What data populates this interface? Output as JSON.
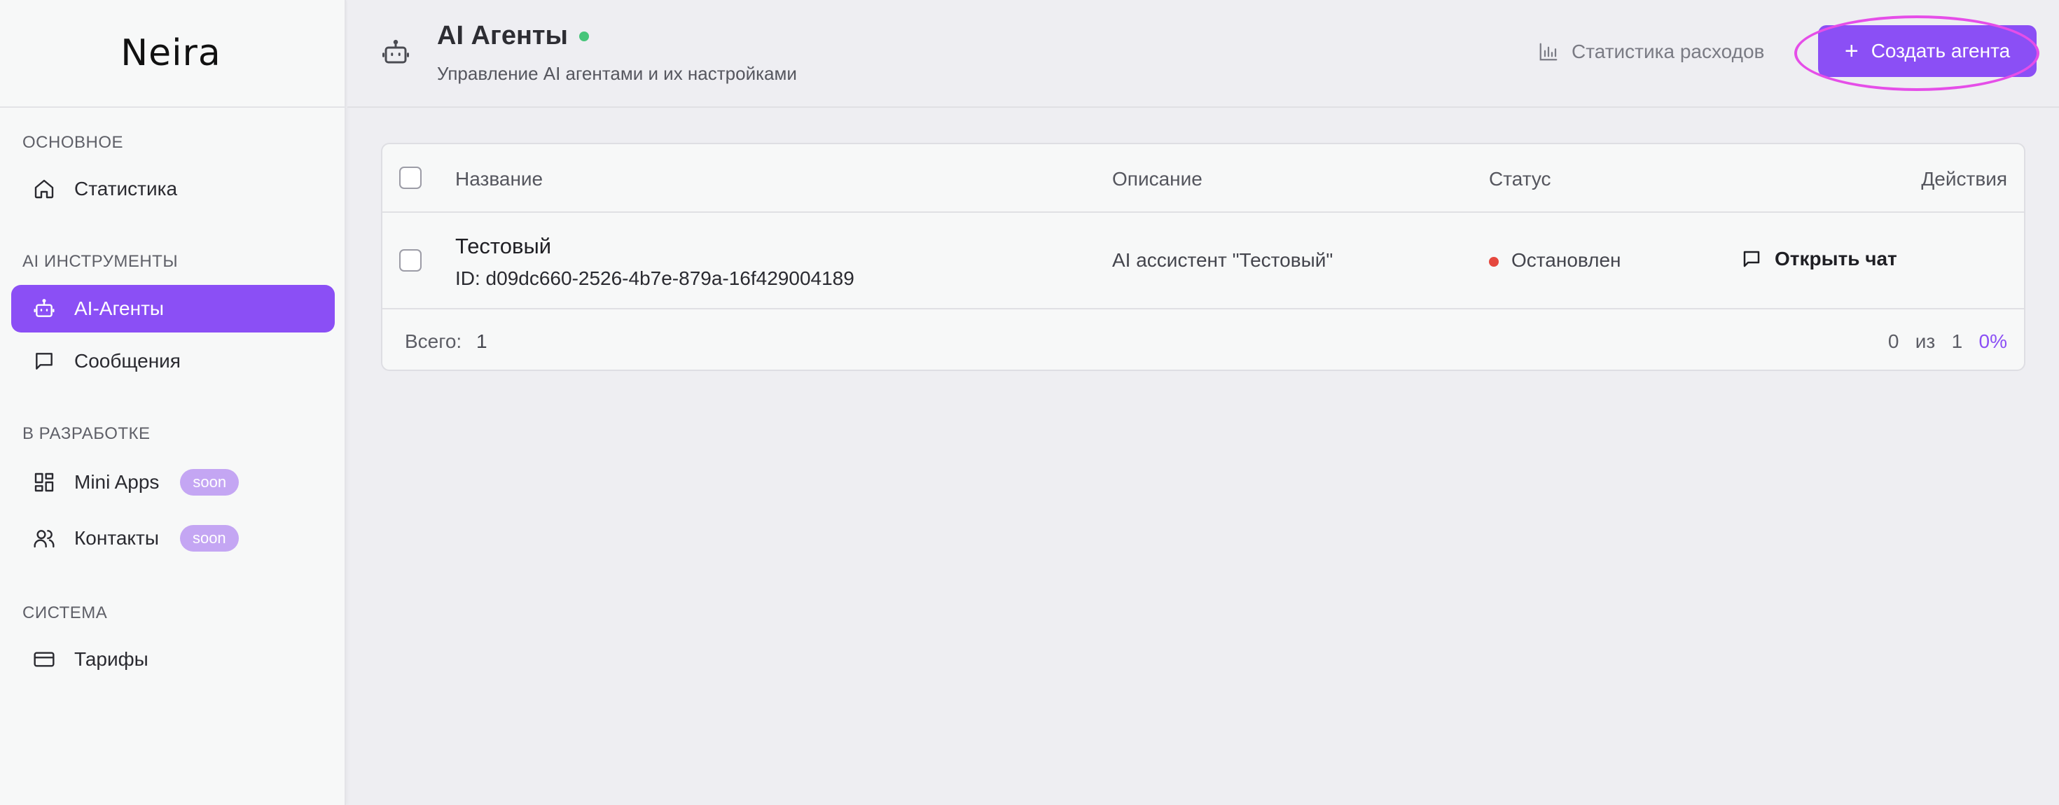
{
  "brand": {
    "logo_text": "Neira"
  },
  "sidebar": {
    "sections": [
      {
        "label": "ОСНОВНОЕ"
      },
      {
        "label": "AI ИНСТРУМЕНТЫ"
      },
      {
        "label": "В РАЗРАБОТКЕ"
      },
      {
        "label": "СИСТЕМА"
      }
    ],
    "items": [
      {
        "label": "Статистика",
        "icon": "home-icon"
      },
      {
        "label": "AI-Агенты",
        "icon": "bot-icon",
        "active": true
      },
      {
        "label": "Сообщения",
        "icon": "message-icon"
      },
      {
        "label": "Mini Apps",
        "icon": "grid-icon",
        "badge": "soon"
      },
      {
        "label": "Контакты",
        "icon": "users-icon",
        "badge": "soon"
      },
      {
        "label": "Тарифы",
        "icon": "card-icon"
      }
    ]
  },
  "header": {
    "title": "AI Агенты",
    "subtitle": "Управление AI агентами и их настройками",
    "stats_link": "Статистика расходов",
    "create_button": "Создать агента"
  },
  "table": {
    "columns": [
      "Название",
      "Описание",
      "Статус",
      "Действия"
    ],
    "rows": [
      {
        "name": "Тестовый",
        "id": "ID: d09dc660-2526-4b7e-879a-16f429004189",
        "description": "AI ассистент \"Тестовый\"",
        "status": "Остановлен",
        "action": "Открыть чат"
      }
    ],
    "footer": {
      "total_label": "Всего:",
      "total_value": "1",
      "selected": "0",
      "of_label": "из",
      "of_value": "1",
      "percent": "0%"
    }
  },
  "colors": {
    "accent": "#8b4ff5",
    "status_stopped": "#e5483e",
    "online": "#46c57a",
    "highlight": "#e54ee8"
  }
}
